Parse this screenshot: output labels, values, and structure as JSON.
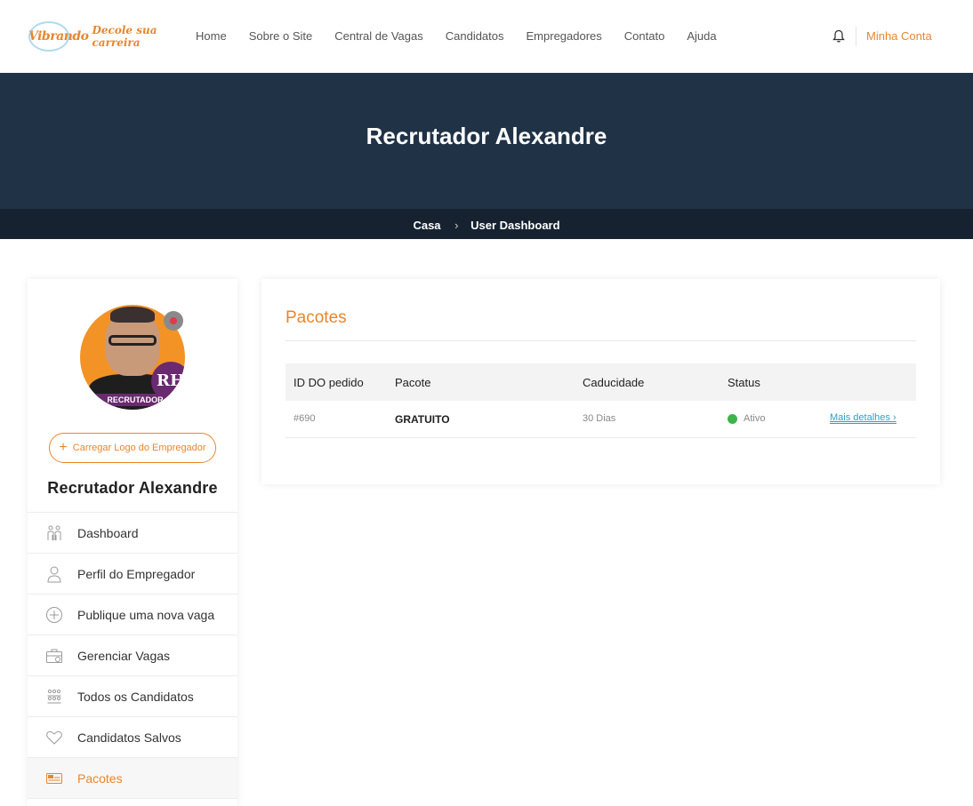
{
  "header": {
    "logo_mark": "Vibrando",
    "logo_text": "Decole sua carreira",
    "nav": [
      "Home",
      "Sobre o Site",
      "Central de Vagas",
      "Candidatos",
      "Empregadores",
      "Contato",
      "Ajuda"
    ],
    "account_label": "Minha Conta"
  },
  "hero": {
    "title": "Recrutador Alexandre",
    "breadcrumb": [
      "Casa",
      "User Dashboard"
    ]
  },
  "sidebar": {
    "avatar_badge": "RH",
    "avatar_band": "RECRUTADOR",
    "upload_label": "Carregar Logo do Empregador",
    "name": "Recrutador Alexandre",
    "menu": [
      {
        "label": "Dashboard",
        "icon": "dashboard-icon"
      },
      {
        "label": "Perfil do Empregador",
        "icon": "user-icon"
      },
      {
        "label": "Publique uma nova vaga",
        "icon": "plus-circle-icon"
      },
      {
        "label": "Gerenciar Vagas",
        "icon": "briefcase-icon"
      },
      {
        "label": "Todos os Candidatos",
        "icon": "group-icon"
      },
      {
        "label": "Candidatos Salvos",
        "icon": "heart-icon"
      },
      {
        "label": "Pacotes",
        "icon": "package-icon",
        "active": true
      }
    ]
  },
  "main": {
    "title": "Pacotes",
    "columns": [
      "ID DO pedido",
      "Pacote",
      "Caducidade",
      "Status"
    ],
    "rows": [
      {
        "id": "#690",
        "package": "GRATUITO",
        "expiry": "30 Dias",
        "status": "Ativo",
        "action": "Mais detalhes"
      }
    ]
  },
  "colors": {
    "accent": "#e9862b",
    "hero_bg": "#203246",
    "crumb_bg": "#16222f",
    "status_active": "#3cb54a",
    "link": "#2a9fd6"
  }
}
